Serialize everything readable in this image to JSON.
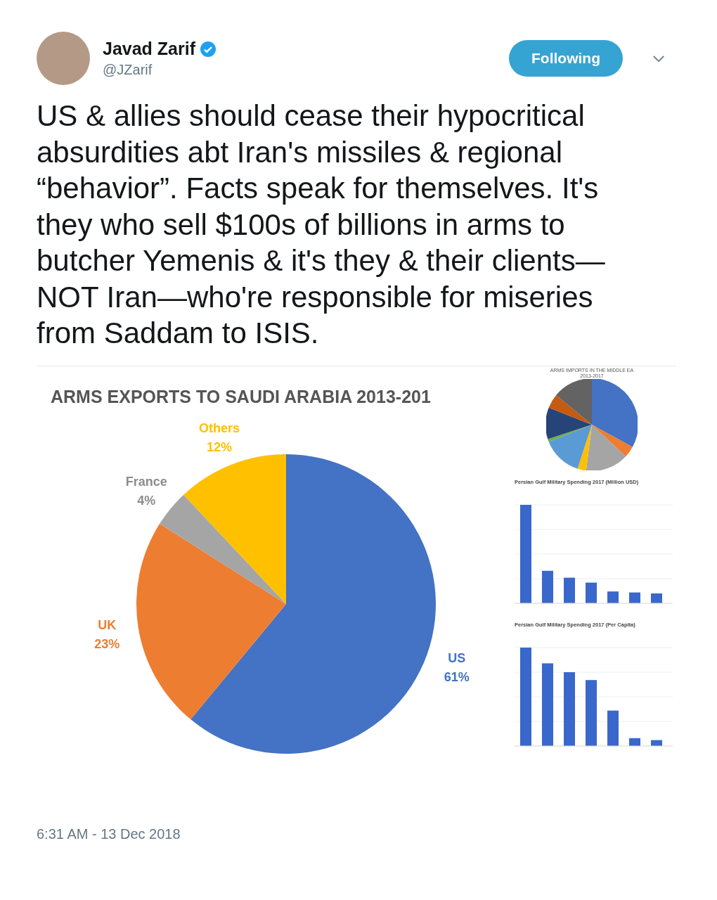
{
  "author": {
    "name": "Javad Zarif",
    "handle": "@JZarif",
    "verified": true
  },
  "follow_button": {
    "label": "Following"
  },
  "tweet_text": "US & allies should cease their hypocritical absurdities abt Iran's missiles & regional “behavior”. Facts speak for themselves. It's they who sell $100s of billions in arms to butcher Yemenis & it's they & their clients—NOT Iran—who're responsible for miseries from Saddam to ISIS.",
  "image": {
    "main_chart": {
      "chart_data": {
        "type": "pie",
        "title": "ARMS EXPORTS TO SAUDI ARABIA 2013-201",
        "categories": [
          "US",
          "UK",
          "France",
          "Others"
        ],
        "values": [
          61,
          23,
          4,
          12
        ],
        "colors": [
          "#4472c4",
          "#ed7d31",
          "#a5a5a5",
          "#ffc000"
        ],
        "value_labels": [
          "61%",
          "23%",
          "4%",
          "12%"
        ]
      }
    },
    "inset_pie": {
      "title_lines": [
        "ARMS IMPORTS IN THE MIDDLE EA",
        "2013-2017"
      ]
    },
    "inset_bars": [
      {
        "title": "Persian Gulf Military Spending 2017 (Million USD)"
      },
      {
        "title": "Persian Gulf Military Spending 2017 (Per Capita)"
      }
    ]
  },
  "timestamp": "6:31 AM - 13 Dec 2018"
}
